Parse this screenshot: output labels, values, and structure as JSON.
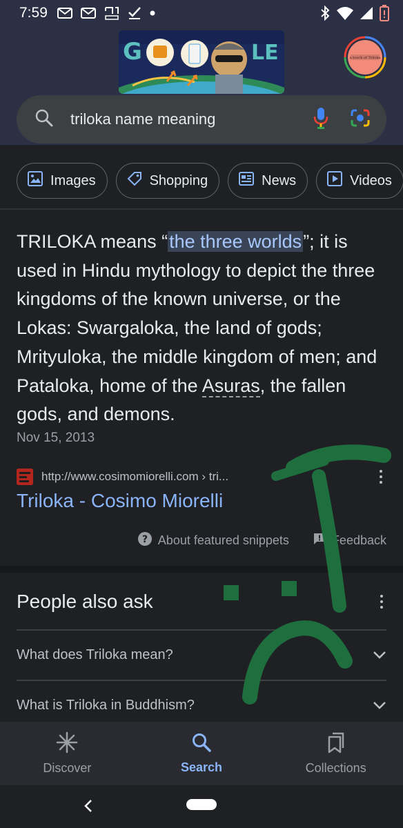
{
  "status_bar": {
    "time": "7:59",
    "left_icons": [
      "mail-icon",
      "mail-icon",
      "hebrew-app-icon",
      "check-icon",
      "dot-icon"
    ],
    "right_icons": [
      "bluetooth-icon",
      "wifi-icon",
      "signal-icon",
      "battery-low-icon"
    ]
  },
  "header": {
    "doodle_letters": "G O O G L E",
    "avatar_text": "a touch of Triloka"
  },
  "search": {
    "query": "triloka name meaning",
    "icons": [
      "search-icon",
      "mic-icon",
      "camera-lens-icon"
    ]
  },
  "chips": [
    {
      "label": "Images",
      "icon": "image-icon"
    },
    {
      "label": "Shopping",
      "icon": "tag-icon"
    },
    {
      "label": "News",
      "icon": "newspaper-icon"
    },
    {
      "label": "Videos",
      "icon": "play-icon"
    }
  ],
  "snippet": {
    "before": "TRILOKA means “",
    "highlight": "the three worlds",
    "after": "”; it is used in Hindu mythology to depict the three kingdoms of the known universe, or the Lokas: Swargaloka, the land of gods; Mrityuloka, the middle kingdom of men; and Pataloka, home of the ",
    "underlined": "Asuras",
    "end": ", the fallen gods, and demons.",
    "date": "Nov 15, 2013",
    "source_url": "http://www.cosimomiorelli.com › tri...",
    "result_title": "Triloka - Cosimo Miorelli",
    "about_label": "About featured snippets",
    "feedback_label": "Feedback"
  },
  "people_also_ask": {
    "title": "People also ask",
    "questions": [
      "What does Triloka mean?",
      "What is Triloka in Buddhism?"
    ]
  },
  "bottom_nav": {
    "items": [
      {
        "label": "Discover",
        "icon": "asterisk-icon",
        "active": false
      },
      {
        "label": "Search",
        "icon": "search-icon",
        "active": true
      },
      {
        "label": "Collections",
        "icon": "bookmarks-icon",
        "active": false
      }
    ]
  },
  "colors": {
    "accent": "#8ab4f8",
    "highlight_bg": "#394457",
    "scribble": "#1f6f3e",
    "background": "#1f2024"
  }
}
